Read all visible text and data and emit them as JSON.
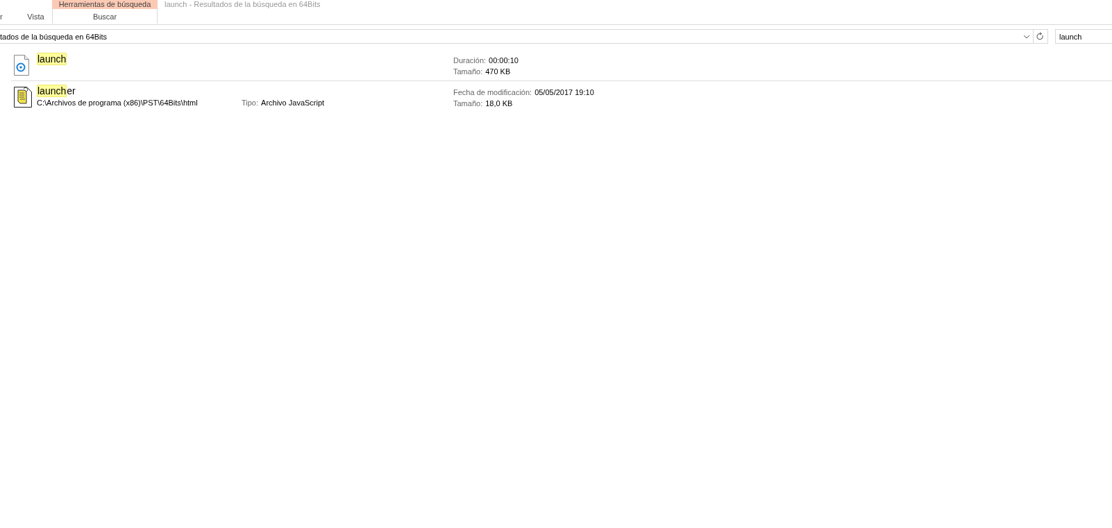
{
  "ribbon": {
    "context_group": "Herramientas de búsqueda",
    "window_title": "launch - Resultados de la búsqueda en 64Bits",
    "tabs": [
      {
        "label": "r",
        "selected": false
      },
      {
        "label": "Vista",
        "selected": false
      },
      {
        "label": "Buscar",
        "selected": true
      }
    ]
  },
  "address_bar": {
    "path": "tados de la búsqueda en 64Bits"
  },
  "search": {
    "value": "launch"
  },
  "results": [
    {
      "kind": "audio",
      "match": "launch",
      "details": [
        {
          "label": "Duración:",
          "value": "00:00:10"
        },
        {
          "label": "Tamaño:",
          "value": "470 KB"
        }
      ]
    },
    {
      "kind": "script",
      "match": "launch",
      "rest": "er",
      "path": "C:\\Archivos de programa (x86)\\PST\\64Bits\\html",
      "type_label": "Tipo:",
      "type_value": "Archivo JavaScript",
      "details": [
        {
          "label": "Fecha de modificación:",
          "value": "05/05/2017 19:10"
        },
        {
          "label": "Tamaño:",
          "value": "18,0 KB"
        }
      ]
    }
  ]
}
